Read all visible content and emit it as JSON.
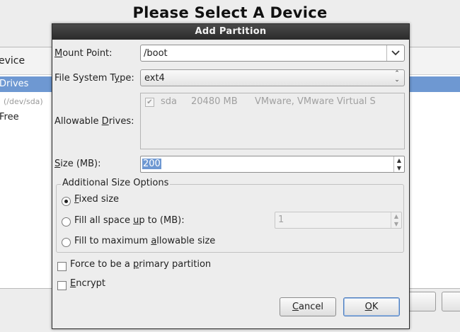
{
  "background": {
    "title": "Please Select A Device",
    "header_label": "evice",
    "selected_row": "Drives",
    "sub_row": "(/dev/sda)",
    "free_row": "Free"
  },
  "dialog": {
    "title": "Add Partition",
    "mount_point": {
      "label_prefix": "M",
      "label_rest": "ount Point:",
      "value": "/boot"
    },
    "fs_type": {
      "label_prefix": "File System T",
      "label_u": "y",
      "label_rest": "pe:",
      "value": "ext4"
    },
    "allowable_drives": {
      "label_prefix": "Allowable ",
      "label_u": "D",
      "label_rest": "rives:",
      "drive": {
        "checked_glyph": "✔",
        "name": "sda",
        "size": "20480 MB",
        "model": "VMware, VMware Virtual S"
      }
    },
    "size": {
      "label_u": "S",
      "label_rest": "ize (MB):",
      "value": "200"
    },
    "additional": {
      "title": "Additional Size Options",
      "options": [
        {
          "label_u": "F",
          "label_rest": "ixed size",
          "selected": true
        },
        {
          "label_prefix": "Fill all space ",
          "label_u": "u",
          "label_rest": "p to (MB):",
          "selected": false
        },
        {
          "label_prefix": "Fill to maximum ",
          "label_u": "a",
          "label_rest": "llowable size",
          "selected": false
        }
      ],
      "fill_up_to_value": "1"
    },
    "force_primary": {
      "label_prefix": "Force to be a ",
      "label_u": "p",
      "label_rest": "rimary partition",
      "checked": false
    },
    "encrypt": {
      "label_u": "E",
      "label_rest": "ncrypt",
      "checked": false
    },
    "buttons": {
      "cancel_u": "C",
      "cancel_rest": "ancel",
      "ok_u": "O",
      "ok_rest": "K"
    }
  }
}
